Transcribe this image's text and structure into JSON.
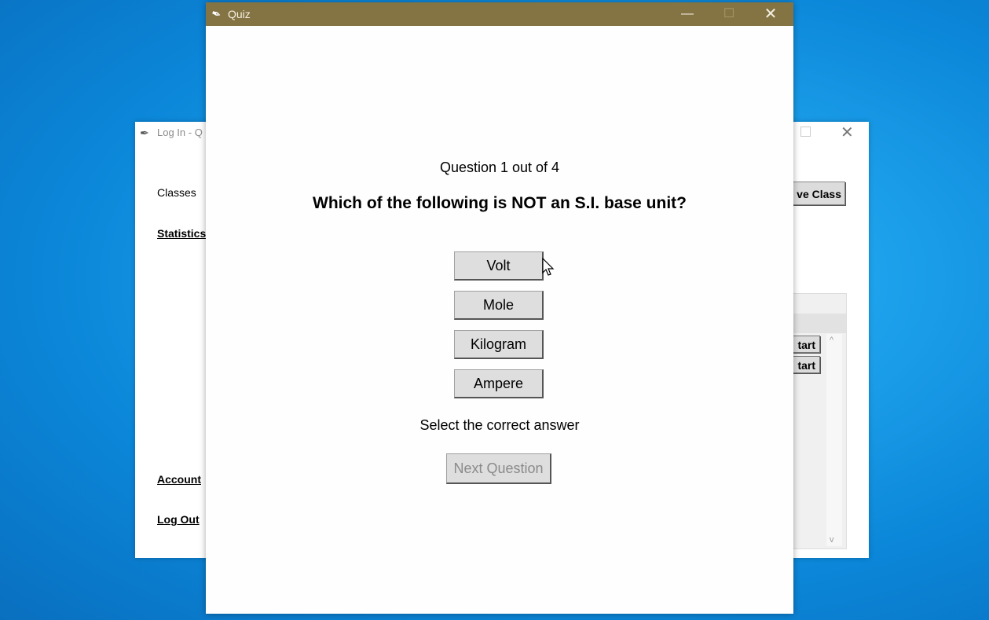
{
  "background_window": {
    "title": "Log In - Q",
    "classes_label": "Classes",
    "statistics_link": "Statistics",
    "account_link": "Account",
    "logout_link": "Log Out",
    "remove_class_button": "ve Class",
    "start_buttons": [
      "tart",
      "tart"
    ]
  },
  "quiz_window": {
    "title": "Quiz",
    "question_counter": "Question 1 out of 4",
    "question_text": "Which of the following is NOT an S.I. base unit?",
    "answers": [
      "Volt",
      "Mole",
      "Kilogram",
      "Ampere"
    ],
    "instruction": "Select the correct answer",
    "next_button": "Next Question"
  },
  "colors": {
    "titlebar": "#857443",
    "desktop": "#1ea2ec",
    "button_face": "#dedede"
  }
}
